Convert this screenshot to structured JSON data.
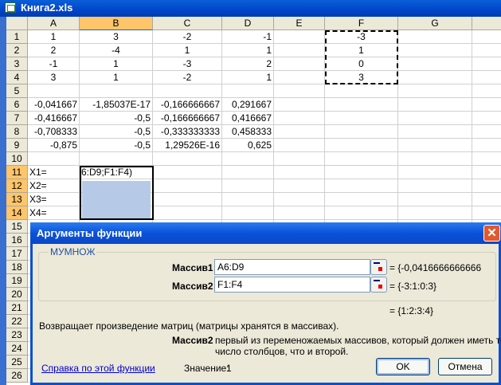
{
  "window": {
    "title": "Книга2.xls"
  },
  "columns": [
    "A",
    "B",
    "C",
    "D",
    "E",
    "F",
    "G"
  ],
  "rows": [
    "1",
    "2",
    "3",
    "4",
    "5",
    "6",
    "7",
    "8",
    "9",
    "10",
    "11",
    "12",
    "13",
    "14",
    "15",
    "16",
    "17",
    "18",
    "19",
    "20",
    "21",
    "22",
    "23",
    "24",
    "25",
    "26"
  ],
  "cells": {
    "r1": [
      "1",
      "3",
      "-2",
      "-1",
      "",
      "-3"
    ],
    "r2": [
      "2",
      "-4",
      "1",
      "1",
      "",
      "1"
    ],
    "r3": [
      "-1",
      "1",
      "-3",
      "2",
      "",
      "0"
    ],
    "r4": [
      "3",
      "1",
      "-2",
      "1",
      "",
      "3"
    ],
    "r6": [
      "-0,041667",
      "-1,85037E-17",
      "-0,166666667",
      "0,291667"
    ],
    "r7": [
      "-0,416667",
      "-0,5",
      "-0,166666667",
      "0,416667"
    ],
    "r8": [
      "-0,708333",
      "-0,5",
      "-0,333333333",
      "0,458333"
    ],
    "r9": [
      "-0,875",
      "-0,5",
      "1,29526E-16",
      "0,625"
    ],
    "r11": [
      "X1=",
      "6:D9;F1:F4)"
    ],
    "r12": [
      "X2="
    ],
    "r13": [
      "X3="
    ],
    "r14": [
      "X4="
    ]
  },
  "dialog": {
    "title": "Аргументы функции",
    "close": "✕",
    "function": "МУМНОЖ",
    "arg1_label": "Массив1",
    "arg1_value": "A6:D9",
    "arg1_result": "= {-0,0416666666666",
    "arg2_label": "Массив2",
    "arg2_value": "F1:F4",
    "arg2_result": "= {-3:1:0:3}",
    "result": "= {1:2:3:4}",
    "description": "Возвращает произведение матриц (матрицы хранятся в массивах).",
    "arg_help_label": "Массив2",
    "arg_help_line1": "первый из переменожаемых массивов, который должен иметь то же",
    "arg_help_line2": "число столбцов, что и второй.",
    "help_link": "Справка по этой функции",
    "value_label": "Значение:",
    "value": "1",
    "ok": "OK",
    "cancel": "Отмена"
  }
}
